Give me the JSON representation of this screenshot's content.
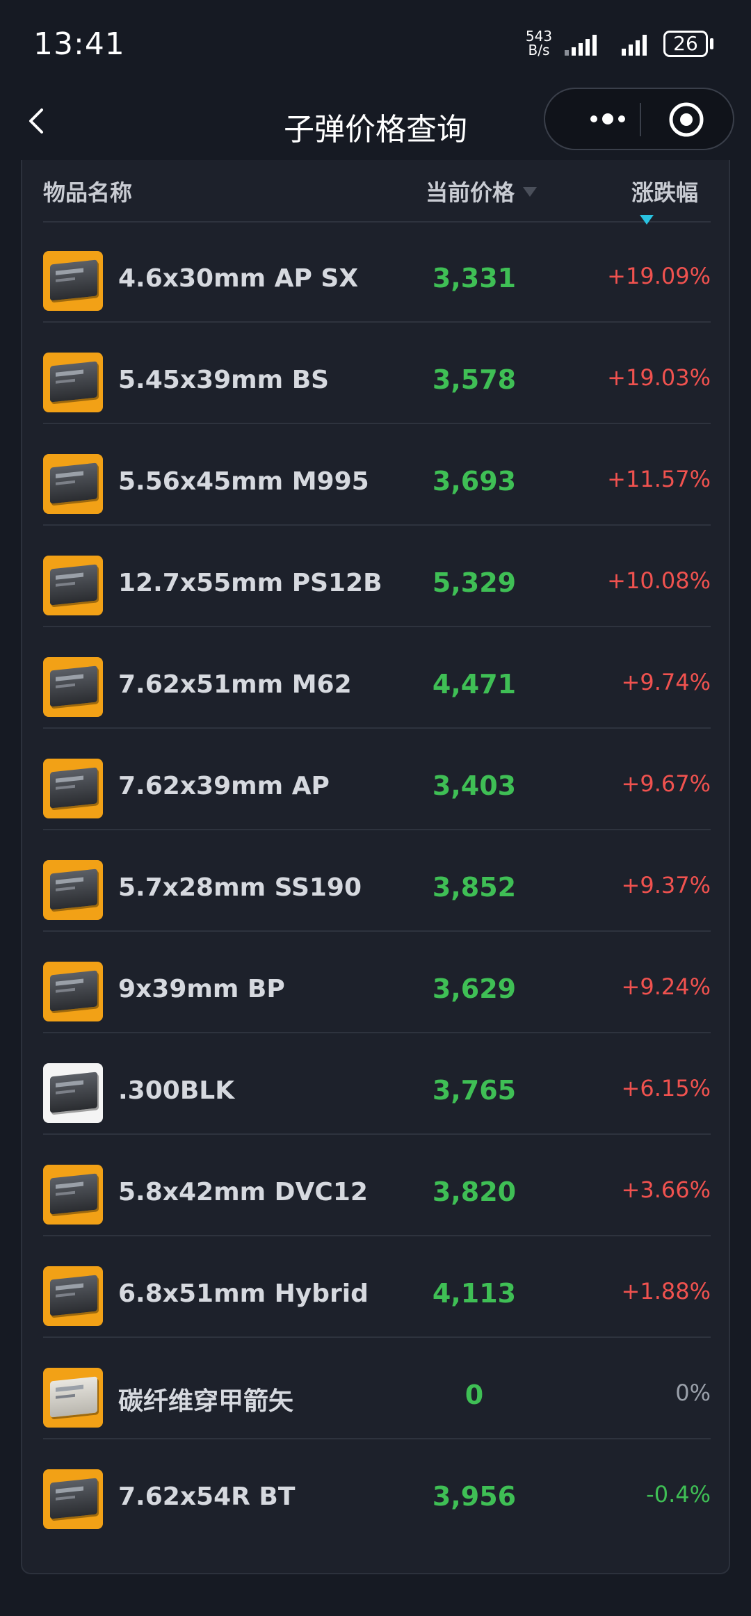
{
  "status_bar": {
    "time": "13:41",
    "net_speed_value": "543",
    "net_speed_unit": "B/s",
    "battery": "26"
  },
  "nav": {
    "title": "子弹价格查询"
  },
  "table": {
    "headers": {
      "name": "物品名称",
      "price": "当前价格",
      "change": "涨跌幅"
    },
    "rows": [
      {
        "name": "4.6x30mm AP SX",
        "price": "3,331",
        "change": "+19.09%",
        "trend": "up",
        "icon": "ammo-box-icon"
      },
      {
        "name": "5.45x39mm BS",
        "price": "3,578",
        "change": "+19.03%",
        "trend": "up",
        "icon": "ammo-box-icon"
      },
      {
        "name": "5.56x45mm M995",
        "price": "3,693",
        "change": "+11.57%",
        "trend": "up",
        "icon": "ammo-box-icon"
      },
      {
        "name": "12.7x55mm PS12B",
        "price": "5,329",
        "change": "+10.08%",
        "trend": "up",
        "icon": "ammo-box-icon"
      },
      {
        "name": "7.62x51mm M62",
        "price": "4,471",
        "change": "+9.74%",
        "trend": "up",
        "icon": "ammo-box-icon"
      },
      {
        "name": "7.62x39mm AP",
        "price": "3,403",
        "change": "+9.67%",
        "trend": "up",
        "icon": "ammo-box-icon"
      },
      {
        "name": "5.7x28mm SS190",
        "price": "3,852",
        "change": "+9.37%",
        "trend": "up",
        "icon": "ammo-box-icon"
      },
      {
        "name": "9x39mm BP",
        "price": "3,629",
        "change": "+9.24%",
        "trend": "up",
        "icon": "ammo-box-icon"
      },
      {
        "name": ".300BLK",
        "price": "3,765",
        "change": "+6.15%",
        "trend": "up",
        "icon": "ammo-box-icon"
      },
      {
        "name": "5.8x42mm DVC12",
        "price": "3,820",
        "change": "+3.66%",
        "trend": "up",
        "icon": "ammo-box-icon"
      },
      {
        "name": "6.8x51mm Hybrid",
        "price": "4,113",
        "change": "+1.88%",
        "trend": "up",
        "icon": "ammo-box-icon"
      },
      {
        "name": "碳纤维穿甲箭矢",
        "price": "0",
        "change": "0%",
        "trend": "flat",
        "icon": "arrow-box-icon"
      },
      {
        "name": "7.62x54R BT",
        "price": "3,956",
        "change": "-0.4%",
        "trend": "down",
        "icon": "ammo-box-icon"
      }
    ]
  },
  "colors": {
    "up": "#f0524f",
    "down": "#3fbf55",
    "flat": "#9aa0aa",
    "price": "#3fbf55",
    "accent": "#29c2e0"
  }
}
